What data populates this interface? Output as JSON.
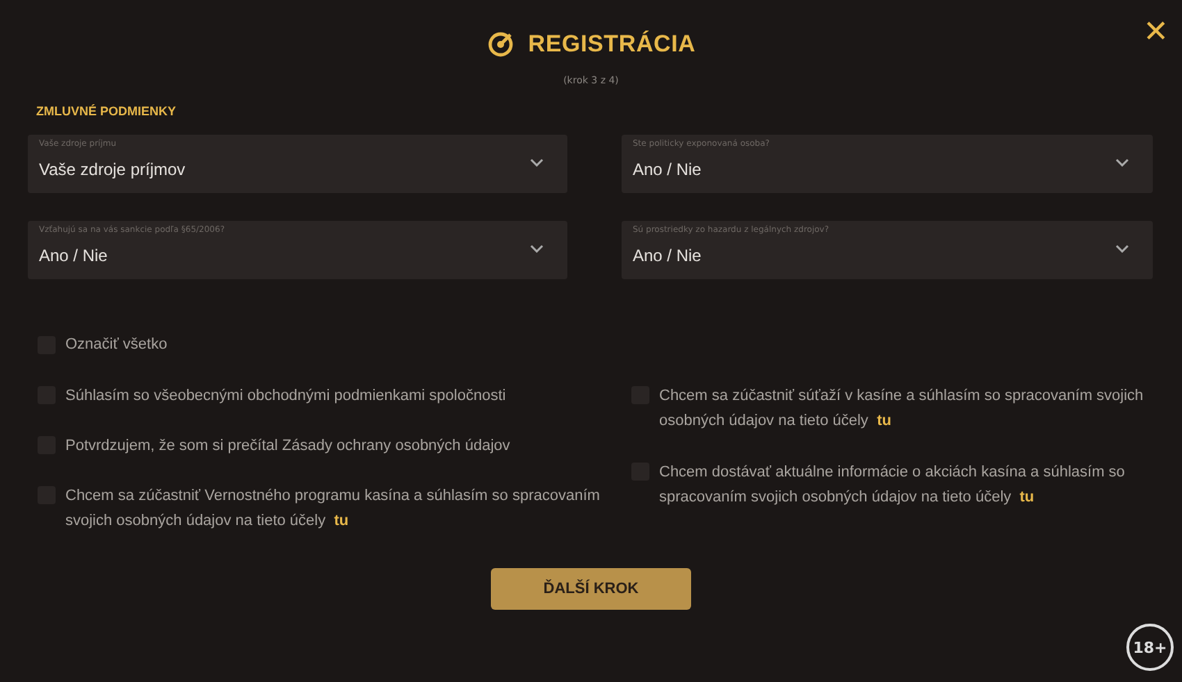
{
  "dialog": {
    "title": "REGISTRÁCIA",
    "step": "(krok 3 z 4)",
    "close": "✕"
  },
  "section": "ZMLUVNÉ PODMIENKY",
  "fields": [
    {
      "label": "Vaše zdroje príjmu",
      "value": "Vaše zdroje príjmov"
    },
    {
      "label": "Ste politicky exponovaná osoba?",
      "value": "Ano / Nie"
    },
    {
      "label": "Vzťahujú sa na vás sankcie podľa §65/2006?",
      "value": "Ano / Nie"
    },
    {
      "label": "Sú prostriedky zo hazardu z legálnych zdrojov?",
      "value": "Ano / Nie"
    }
  ],
  "select_all": {
    "label": "Označiť všetko",
    "checked": false
  },
  "consents_left": [
    {
      "text": "Súhlasím so všeobecnými obchodnými podmienkami spoločnosti",
      "checked": false
    },
    {
      "text": "Potvrdzujem, že som si prečítal Zásady ochrany osobných údajov",
      "checked": false
    },
    {
      "text": "Chcem sa zúčastniť Vernostného programu kasína a súhlasím so spracovaním svojich osobných údajov na tieto účely",
      "link": "tu",
      "checked": false
    }
  ],
  "consents_right": [
    {
      "text": "Chcem sa zúčastniť súťaží v kasíne a súhlasím so spracovaním svojich osobných údajov na tieto účely",
      "link": "tu",
      "checked": false
    },
    {
      "text": "Chcem dostávať aktuálne informácie o akciách kasína a súhlasím so spracovaním svojich osobných údajov na tieto účely",
      "link": "tu",
      "checked": false
    }
  ],
  "next_button": "ĎALŠÍ KROK",
  "age_badge": "18+"
}
